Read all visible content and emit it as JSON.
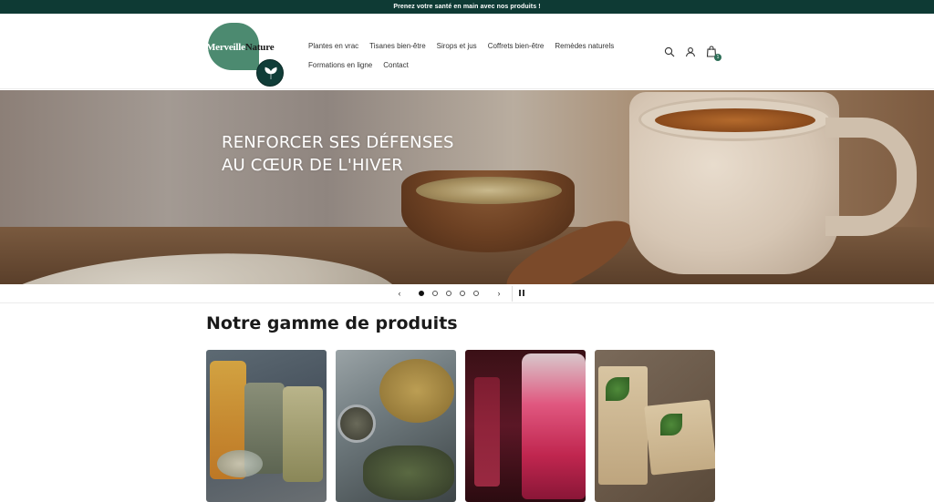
{
  "announcement": {
    "text": "Prenez votre santé en main avec nos produits !"
  },
  "header": {
    "logo": {
      "part1": "Merveille",
      "part2": "Nature"
    },
    "nav": {
      "row1": [
        "Plantes en vrac",
        "Tisanes bien-être",
        "Sirops et jus",
        "Coffrets bien-être",
        "Remèdes naturels"
      ],
      "row2": [
        "Formations en ligne",
        "Contact"
      ]
    },
    "icons": [
      "search-icon",
      "account-icon",
      "cart-icon"
    ],
    "cart_count": "1"
  },
  "hero": {
    "title_line1": "RENFORCER SES DÉFENSES",
    "title_line2": "AU CŒUR DE L'HIVER"
  },
  "slider": {
    "slides": 5,
    "active_index": 0
  },
  "products_section": {
    "title": "Notre gamme de produits"
  },
  "colors": {
    "announcement_bg": "#0e3a34",
    "brand_green": "#4c8a70",
    "text_dark": "#1a1a1a"
  }
}
